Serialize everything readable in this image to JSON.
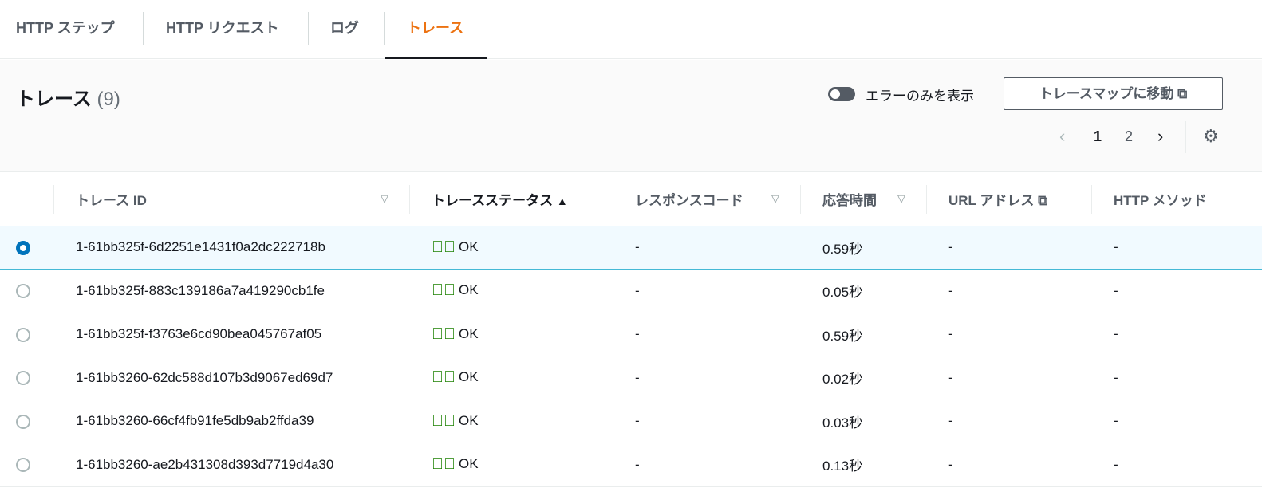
{
  "tabs": [
    {
      "label": "HTTP ステップ"
    },
    {
      "label": "HTTP リクエスト"
    },
    {
      "label": "ログ"
    },
    {
      "label": "トレース"
    }
  ],
  "section": {
    "title": "トレース",
    "count": "(9)",
    "toggle_label": "エラーのみを表示",
    "toggle_on": false,
    "map_button": "トレースマップに移動"
  },
  "pagination": {
    "pages": [
      "1",
      "2"
    ],
    "current": "1"
  },
  "columns": [
    "トレース ID",
    "トレースステータス",
    "レスポンスコード",
    "応答時間",
    "URL アドレス",
    "HTTP メソッド"
  ],
  "rows": [
    {
      "id": "1-61bb325f-6d2251e1431f0a2dc222718b",
      "status": "OK",
      "code": "-",
      "time": "0.59秒",
      "url": "-",
      "method": "-",
      "selected": true
    },
    {
      "id": "1-61bb325f-883c139186a7a419290cb1fe",
      "status": "OK",
      "code": "-",
      "time": "0.05秒",
      "url": "-",
      "method": "-"
    },
    {
      "id": "1-61bb325f-f3763e6cd90bea045767af05",
      "status": "OK",
      "code": "-",
      "time": "0.59秒",
      "url": "-",
      "method": "-"
    },
    {
      "id": "1-61bb3260-62dc588d107b3d9067ed69d7",
      "status": "OK",
      "code": "-",
      "time": "0.02秒",
      "url": "-",
      "method": "-"
    },
    {
      "id": "1-61bb3260-66cf4fb91fe5db9ab2ffda39",
      "status": "OK",
      "code": "-",
      "time": "0.03秒",
      "url": "-",
      "method": "-"
    },
    {
      "id": "1-61bb3260-ae2b431308d393d7719d4a30",
      "status": "OK",
      "code": "-",
      "time": "0.13秒",
      "url": "-",
      "method": "-"
    }
  ]
}
